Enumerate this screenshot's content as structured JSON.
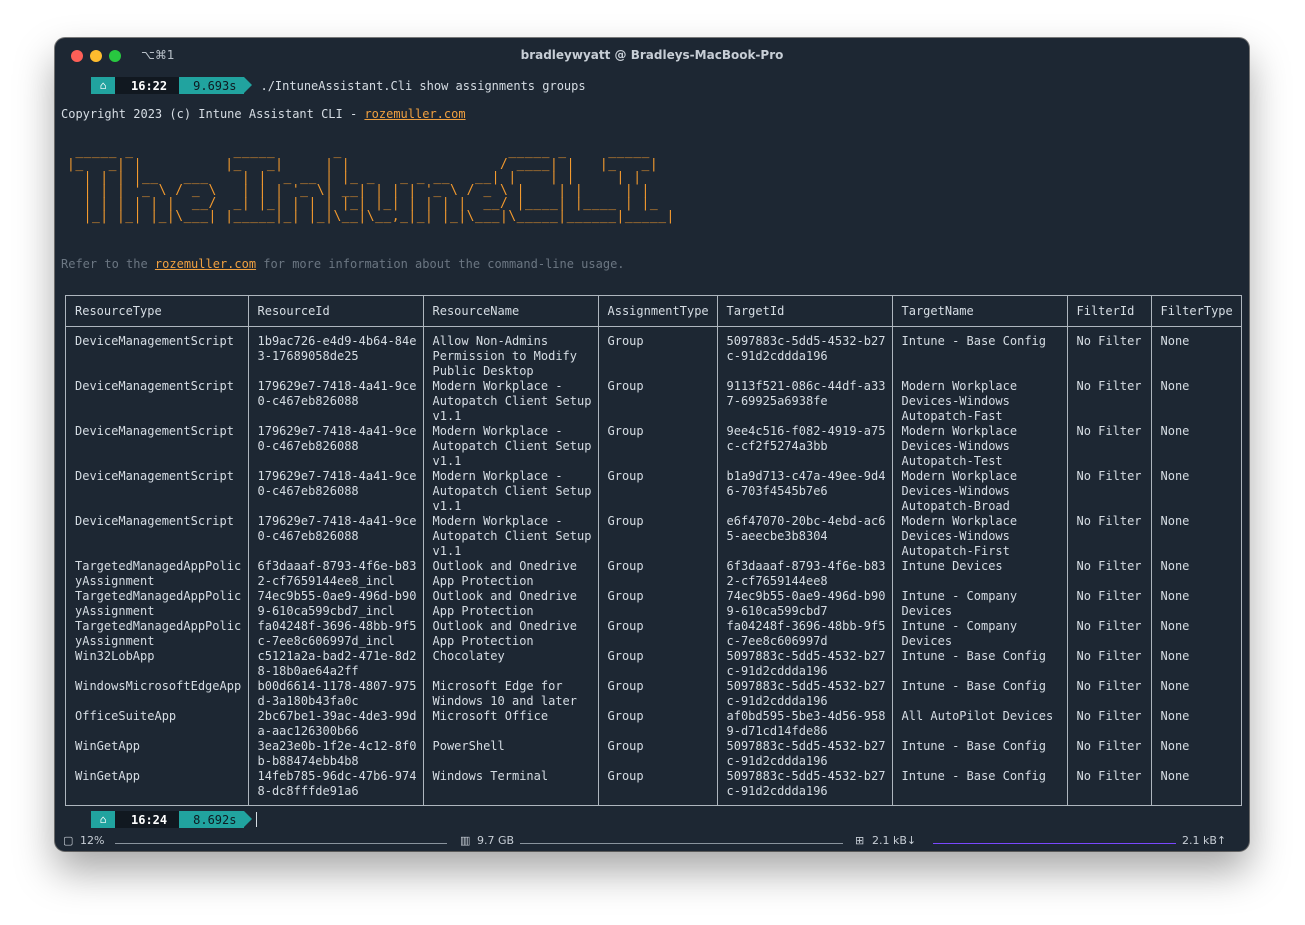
{
  "window": {
    "shortcut": "⌥⌘1",
    "title": "bradleywyatt @ Bradleys-MacBook-Pro"
  },
  "prompt1": {
    "apple_icon": "",
    "home_icon": "⌂",
    "time": "16:22",
    "duration": "9.693s",
    "command": "./IntuneAssistant.Cli show assignments groups"
  },
  "copyright": {
    "prefix": "Copyright 2023 (c) Intune Assistant CLI - ",
    "link": "rozemuller.com"
  },
  "banner_text": "The IntuneCLI",
  "refer": {
    "prefix": "Refer to the ",
    "link": "rozemuller.com",
    "suffix": " for more information about the command-line usage."
  },
  "table": {
    "headers": [
      "ResourceType",
      "ResourceId",
      "ResourceName",
      "AssignmentType",
      "TargetId",
      "TargetName",
      "FilterId",
      "FilterType"
    ],
    "rows": [
      [
        "DeviceManagementScript",
        "1b9ac726-e4d9-4b64-84e\n3-17689058de25",
        "Allow Non-Admins\nPermission to Modify\nPublic Desktop",
        "Group",
        "5097883c-5dd5-4532-b27\nc-91d2cddda196",
        "Intune - Base Config",
        "No Filter",
        "None"
      ],
      [
        "DeviceManagementScript",
        "179629e7-7418-4a41-9ce\n0-c467eb826088",
        "Modern Workplace -\nAutopatch Client Setup\nv1.1",
        "Group",
        "9113f521-086c-44df-a33\n7-69925a6938fe",
        "Modern Workplace\nDevices-Windows\nAutopatch-Fast",
        "No Filter",
        "None"
      ],
      [
        "DeviceManagementScript",
        "179629e7-7418-4a41-9ce\n0-c467eb826088",
        "Modern Workplace -\nAutopatch Client Setup\nv1.1",
        "Group",
        "9ee4c516-f082-4919-a75\nc-cf2f5274a3bb",
        "Modern Workplace\nDevices-Windows\nAutopatch-Test",
        "No Filter",
        "None"
      ],
      [
        "DeviceManagementScript",
        "179629e7-7418-4a41-9ce\n0-c467eb826088",
        "Modern Workplace -\nAutopatch Client Setup\nv1.1",
        "Group",
        "b1a9d713-c47a-49ee-9d4\n6-703f4545b7e6",
        "Modern Workplace\nDevices-Windows\nAutopatch-Broad",
        "No Filter",
        "None"
      ],
      [
        "DeviceManagementScript",
        "179629e7-7418-4a41-9ce\n0-c467eb826088",
        "Modern Workplace -\nAutopatch Client Setup\nv1.1",
        "Group",
        "e6f47070-20bc-4ebd-ac6\n5-aeecbe3b8304",
        "Modern Workplace\nDevices-Windows\nAutopatch-First",
        "No Filter",
        "None"
      ],
      [
        "TargetedManagedAppPolic\nyAssignment",
        "6f3daaaf-8793-4f6e-b83\n2-cf7659144ee8_incl",
        "Outlook and Onedrive\nApp Protection",
        "Group",
        "6f3daaaf-8793-4f6e-b83\n2-cf7659144ee8",
        "Intune Devices",
        "No Filter",
        "None"
      ],
      [
        "TargetedManagedAppPolic\nyAssignment",
        "74ec9b55-0ae9-496d-b90\n9-610ca599cbd7_incl",
        "Outlook and Onedrive\nApp Protection",
        "Group",
        "74ec9b55-0ae9-496d-b90\n9-610ca599cbd7",
        "Intune - Company\nDevices",
        "No Filter",
        "None"
      ],
      [
        "TargetedManagedAppPolic\nyAssignment",
        "fa04248f-3696-48bb-9f5\nc-7ee8c606997d_incl",
        "Outlook and Onedrive\nApp Protection",
        "Group",
        "fa04248f-3696-48bb-9f5\nc-7ee8c606997d",
        "Intune - Company\nDevices",
        "No Filter",
        "None"
      ],
      [
        "Win32LobApp",
        "c5121a2a-bad2-471e-8d2\n8-18b0ae64a2ff",
        "Chocolatey",
        "Group",
        "5097883c-5dd5-4532-b27\nc-91d2cddda196",
        "Intune - Base Config",
        "No Filter",
        "None"
      ],
      [
        "WindowsMicrosoftEdgeApp",
        "b00d6614-1178-4807-975\nd-3a180b43fa0c",
        "Microsoft Edge for\nWindows 10 and later",
        "Group",
        "5097883c-5dd5-4532-b27\nc-91d2cddda196",
        "Intune - Base Config",
        "No Filter",
        "None"
      ],
      [
        "OfficeSuiteApp",
        "2bc67be1-39ac-4de3-99d\na-aac126300b66",
        "Microsoft Office",
        "Group",
        "af0bd595-5be3-4d56-958\n9-d71cd14fde86",
        "All AutoPilot Devices",
        "No Filter",
        "None"
      ],
      [
        "WinGetApp",
        "3ea23e0b-1f2e-4c12-8f0\nb-b88474ebb4b8",
        "PowerShell",
        "Group",
        "5097883c-5dd5-4532-b27\nc-91d2cddda196",
        "Intune - Base Config",
        "No Filter",
        "None"
      ],
      [
        "WinGetApp",
        "14feb785-96dc-47b6-974\n8-dc8fffde91a6",
        "Windows Terminal",
        "Group",
        "5097883c-5dd5-4532-b27\nc-91d2cddda196",
        "Intune - Base Config",
        "No Filter",
        "None"
      ]
    ]
  },
  "prompt2": {
    "apple_icon": "",
    "home_icon": "⌂",
    "time": "16:24",
    "duration": "8.692s"
  },
  "statusbar": {
    "cpu": "12%",
    "memory": "9.7 GB",
    "net_down": "2.1 kB↓",
    "net_up": "2.1 kB↑"
  }
}
